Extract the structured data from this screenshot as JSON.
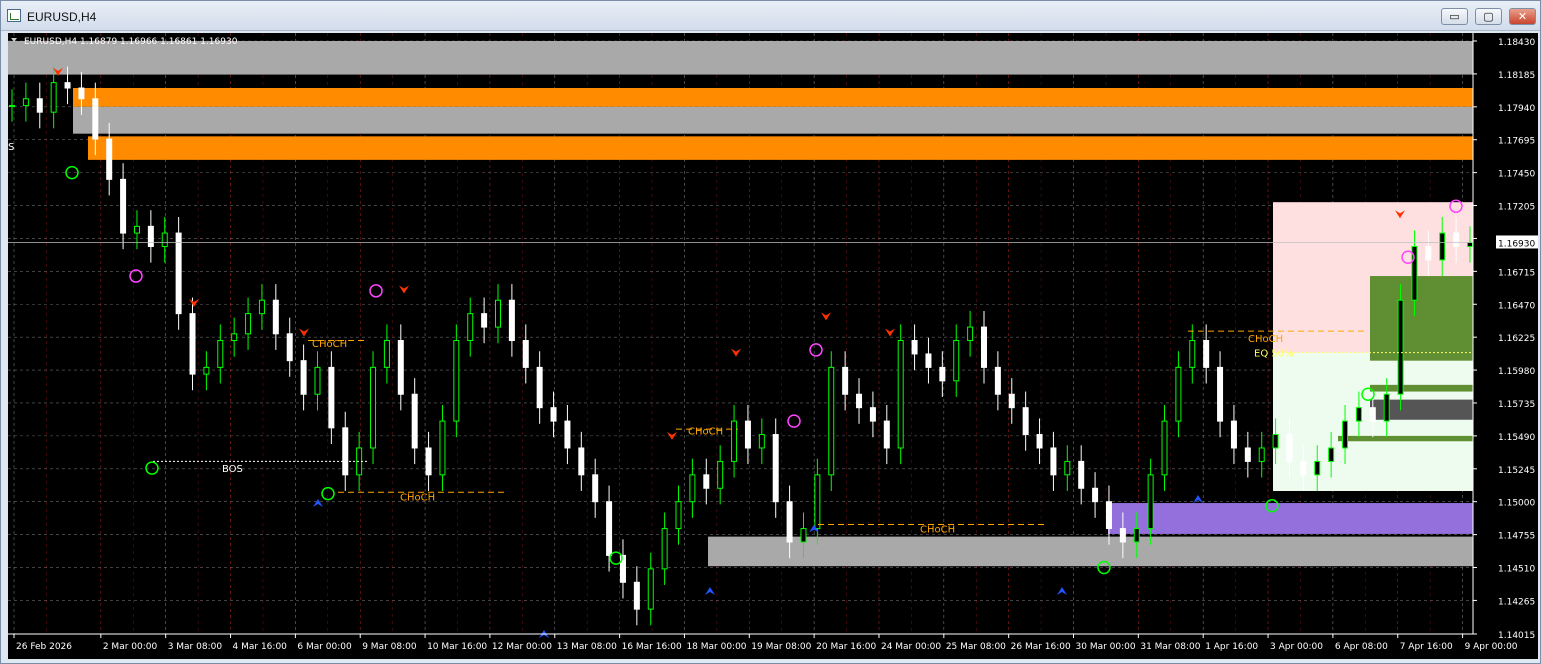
{
  "window": {
    "title": "EURUSD,H4",
    "buttons": {
      "minimize": "▭",
      "maximize": "▢",
      "close": "✕"
    }
  },
  "chart": {
    "header": "EURUSD,H4  1.16879 1.16966 1.16861 1.16930",
    "symbol": "EURUSD",
    "timeframe": "H4",
    "ohlc": {
      "open": 1.16879,
      "high": 1.16966,
      "low": 1.16861,
      "close": 1.1693
    },
    "current_price_label": "1.16930",
    "colors": {
      "background": "#000000",
      "grid": "#c0c0c0",
      "bull": "#00ff00",
      "bear": "#ffffff",
      "orange_zone": "#ff8c00",
      "grey_zone": "#a9a9a9",
      "purple_zone": "#9370db",
      "choch": "#ffa500",
      "pink_zone": "#ffe0e0"
    }
  },
  "chart_data": {
    "type": "candlestick",
    "symbol": "EURUSD",
    "timeframe": "H4",
    "y_ticks": [
      "1.18430",
      "1.18185",
      "1.17940",
      "1.17695",
      "1.17450",
      "1.17205",
      "1.16960",
      "1.16715",
      "1.16470",
      "1.16225",
      "1.15980",
      "1.15735",
      "1.15490",
      "1.15245",
      "1.15000",
      "1.14755",
      "1.14510",
      "1.14265",
      "1.14015"
    ],
    "ylim": [
      1.14015,
      1.1843
    ],
    "x_ticks": [
      "26 Feb 2026",
      "2 Mar 00:00",
      "3 Mar 08:00",
      "4 Mar 16:00",
      "6 Mar 00:00",
      "9 Mar 08:00",
      "10 Mar 16:00",
      "12 Mar 00:00",
      "13 Mar 08:00",
      "16 Mar 16:00",
      "18 Mar 00:00",
      "19 Mar 08:00",
      "20 Mar 16:00",
      "24 Mar 00:00",
      "25 Mar 08:00",
      "26 Mar 16:00",
      "30 Mar 00:00",
      "31 Mar 08:00",
      "1 Apr 16:00",
      "3 Apr 00:00",
      "6 Apr 08:00",
      "7 Apr 16:00",
      "9 Apr 00:00"
    ],
    "grid": true,
    "close_path": [
      1.1795,
      1.18,
      1.179,
      1.1812,
      1.1808,
      1.18,
      1.177,
      1.174,
      1.17,
      1.1705,
      1.169,
      1.17,
      1.164,
      1.1595,
      1.16,
      1.162,
      1.1625,
      1.164,
      1.165,
      1.1625,
      1.1605,
      1.158,
      1.16,
      1.1555,
      1.152,
      1.154,
      1.16,
      1.162,
      1.158,
      1.154,
      1.152,
      1.156,
      1.162,
      1.164,
      1.163,
      1.165,
      1.162,
      1.16,
      1.157,
      1.156,
      1.154,
      1.152,
      1.15,
      1.146,
      1.144,
      1.142,
      1.145,
      1.148,
      1.15,
      1.152,
      1.151,
      1.153,
      1.156,
      1.154,
      1.155,
      1.15,
      1.147,
      1.148,
      1.152,
      1.16,
      1.158,
      1.157,
      1.156,
      1.154,
      1.162,
      1.161,
      1.16,
      1.159,
      1.162,
      1.163,
      1.16,
      1.158,
      1.157,
      1.155,
      1.154,
      1.152,
      1.153,
      1.151,
      1.15,
      1.148,
      1.147,
      1.148,
      1.152,
      1.156,
      1.16,
      1.162,
      1.16,
      1.156,
      1.154,
      1.153,
      1.154,
      1.155,
      1.153,
      1.152,
      1.153,
      1.154,
      1.156,
      1.157,
      1.156,
      1.158,
      1.165,
      1.169,
      1.168,
      1.17,
      1.169,
      1.1693
    ],
    "annotations": [
      "CHoCH",
      "CHoCH",
      "CHoCH",
      "CHoCH",
      "CHoCH",
      "BOS",
      "EQ 50%"
    ]
  },
  "labels": {
    "bos": "BOS",
    "choch": "CHoCH",
    "eq": "EQ 50%",
    "s_marker": "S"
  }
}
